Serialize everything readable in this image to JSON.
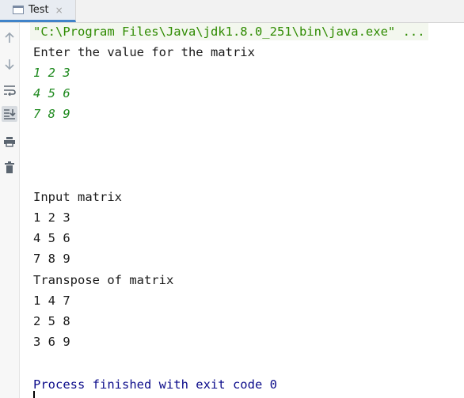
{
  "tab": {
    "label": "Test",
    "close": "×"
  },
  "gutter": {
    "icons": [
      "arrow-up-icon",
      "arrow-down-icon",
      "soft-wrap-icon",
      "scroll-to-end-icon",
      "print-icon",
      "trash-icon"
    ]
  },
  "console": {
    "command": "\"C:\\Program Files\\Java\\jdk1.8.0_251\\bin\\java.exe\" ...",
    "prompt": "Enter the value for the matrix",
    "input_rows": [
      "1 2 3",
      "4 5 6",
      "7 8 9"
    ],
    "input_heading": "Input matrix",
    "input_matrix": [
      "1 2 3",
      "4 5 6",
      "7 8 9"
    ],
    "transpose_heading": "Transpose of matrix",
    "transpose_matrix": [
      "1 4 7",
      "2 5 8",
      "3 6 9"
    ],
    "exit_message": "Process finished with exit code 0"
  },
  "colors": {
    "command": "#2e8b00",
    "user_input": "#1f8a1f",
    "exit": "#0b0b8a",
    "tab_accent": "#4083c9"
  }
}
